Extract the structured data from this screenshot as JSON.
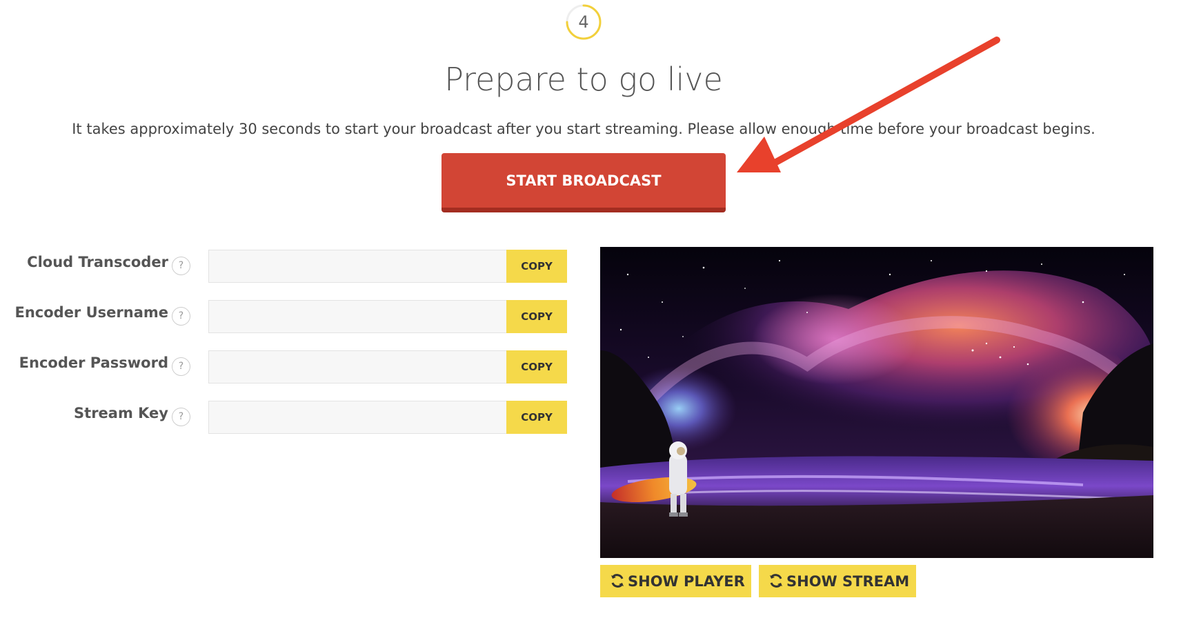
{
  "step": {
    "number": "4",
    "progress_fraction": 0.75,
    "ring_color": "#f2d03b"
  },
  "title": "Prepare to go live",
  "subtitle": "It takes approximately 30 seconds to start your broadcast after you start streaming. Please allow enough time before your broadcast begins.",
  "start_button": {
    "label": "START BROADCAST",
    "color": "#d24535"
  },
  "fields": [
    {
      "label": "Cloud Transcoder",
      "help": "?",
      "value": "",
      "copy_label": "COPY"
    },
    {
      "label": "Encoder Username",
      "help": "?",
      "value": "",
      "copy_label": "COPY"
    },
    {
      "label": "Encoder Password",
      "help": "?",
      "value": "",
      "copy_label": "COPY"
    },
    {
      "label": "Stream Key",
      "help": "?",
      "value": "",
      "copy_label": "COPY"
    }
  ],
  "preview": {
    "image": "astronaut-surfer-nebula-beach"
  },
  "buttons": {
    "show_player": "SHOW PLAYER",
    "show_stream": "SHOW STREAM",
    "icon": "refresh-icon",
    "color": "#f5d94a"
  },
  "annotation": {
    "icon": "red-arrow",
    "color": "#e8412c"
  }
}
